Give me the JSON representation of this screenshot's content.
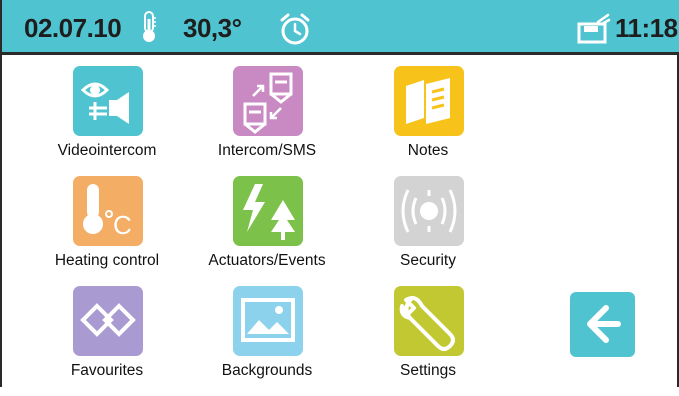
{
  "status": {
    "date": "02.07.10",
    "temperature": "30,3°",
    "time": "11:18",
    "icons": [
      "thermometer-icon",
      "timer-icon",
      "message-box-icon"
    ]
  },
  "apps": [
    {
      "label": "Videointercom",
      "icon": "videointercom-icon",
      "color": "#4fc3cf"
    },
    {
      "label": "Intercom/SMS",
      "icon": "intercom-sms-icon",
      "color": "#c98ac4"
    },
    {
      "label": "Notes",
      "icon": "notes-icon",
      "color": "#f7c21a"
    },
    {
      "label": "Heating control",
      "icon": "thermometer-icon",
      "color": "#f4ad64"
    },
    {
      "label": "Actuators/Events",
      "icon": "actuators-icon",
      "color": "#7cc24a"
    },
    {
      "label": "Security",
      "icon": "alarm-icon",
      "color": "#d3d3d3"
    },
    {
      "label": "Favourites",
      "icon": "favourites-icon",
      "color": "#a99ad1"
    },
    {
      "label": "Backgrounds",
      "icon": "image-icon",
      "color": "#8dd2ec"
    },
    {
      "label": "Settings",
      "icon": "wrench-icon",
      "color": "#c2c832"
    }
  ],
  "back_button": {
    "icon": "arrow-left-icon",
    "color": "#4fc3cf"
  }
}
